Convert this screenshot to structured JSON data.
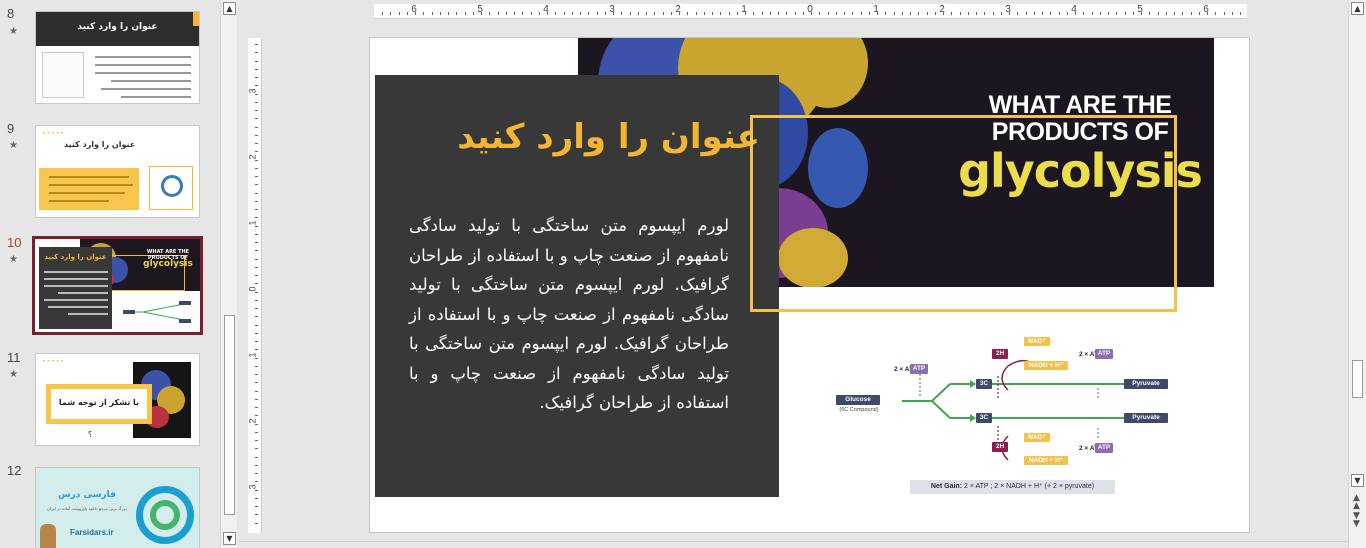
{
  "thumbnails": [
    {
      "number": "8",
      "star": "★",
      "title": "عنوان را وارد کنید"
    },
    {
      "number": "9",
      "star": "★",
      "title": "عنوان را وارد کنید",
      "dots": "•••••"
    },
    {
      "number": "10",
      "star": "★",
      "title": "عنوان را وارد کنید",
      "img_line1": "WHAT ARE THE",
      "img_line2": "PRODUCTS OF",
      "img_line3": "glycolysis"
    },
    {
      "number": "11",
      "star": "★",
      "title": "با تشکر از توجه شما",
      "question": "؟",
      "dots": "•••••"
    },
    {
      "number": "12",
      "brand": "فارسی درس",
      "tagline": "بزرگ ترین مرجع دانلود پاورپوینت آماده در ایران",
      "url": "Farsidars.ir"
    }
  ],
  "scroll": {
    "up": "▲",
    "down": "▼"
  },
  "ruler": {
    "h_labels": [
      "6",
      "5",
      "4",
      "3",
      "2",
      "1",
      "0",
      "1",
      "2",
      "3",
      "4",
      "5",
      "6"
    ],
    "v_labels": [
      "3",
      "2",
      "1",
      "0",
      "1",
      "2",
      "3"
    ]
  },
  "slide": {
    "title": "عنوان را وارد کنید",
    "body": "لورم ایپسوم متن ساختگی با تولید سادگی نامفهوم از صنعت چاپ و با استفاده از طراحان گرافیک. لورم ایپسوم متن ساختگی با تولید سادگی نامفهوم از صنعت چاپ و با استفاده از طراحان گرافیک. لورم ایپسوم متن ساختگی با تولید سادگی نامفهوم از صنعت چاپ و با استفاده از طراحان گرافیک.",
    "image": {
      "line1": "WHAT ARE THE",
      "line2": "PRODUCTS OF",
      "line3": "glycolysis"
    },
    "diagram": {
      "glucose": "Glucose",
      "glucose_sub": "(6C Compound)",
      "atp_in": "2 × ATP",
      "atp_box": "ATP",
      "three_c": "3C",
      "pyruvate": "Pyruvate",
      "two_h": "2H",
      "nad": "NAD⁺",
      "nadh": "NADH + H⁺",
      "atp_out": "2 × ATP",
      "atp_out_box": "ATP",
      "net_gain_label": "Net Gain:",
      "net_gain_value": "2 × ATP  ;  2 × NADH + H⁺  (+ 2 × pyruvate)"
    }
  },
  "colors": {
    "accent": "#f2b632",
    "dark_panel": "#383838",
    "selection": "#7a1f2b",
    "diagram_arrow": "#3fa74f",
    "diagram_purple": "#8a6fb0",
    "diagram_navy": "#3f4a6b",
    "diagram_maroon": "#8c1e50"
  }
}
